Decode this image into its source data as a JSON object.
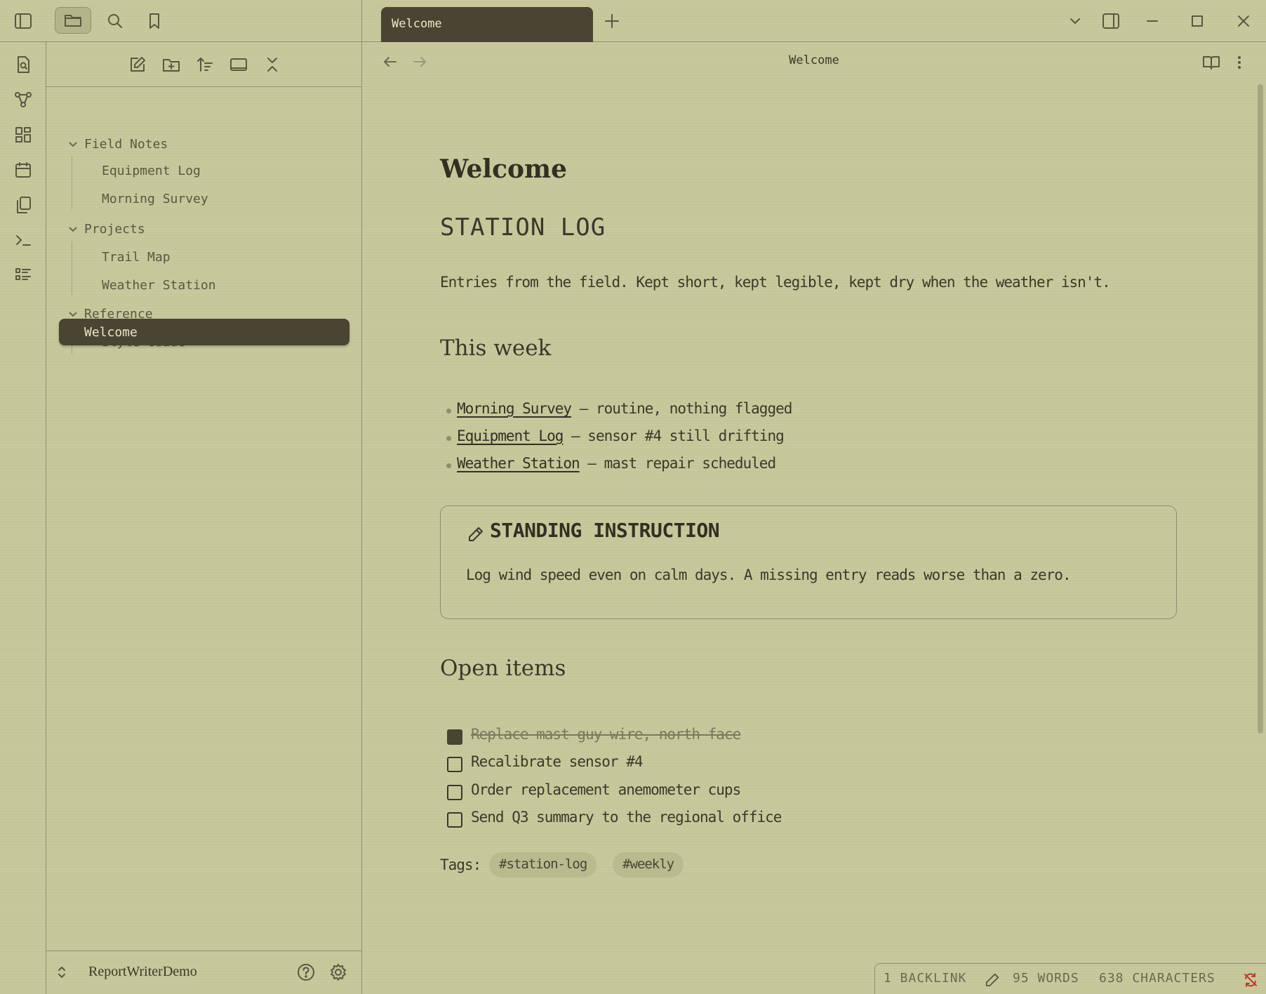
{
  "tabs": [
    {
      "label": "Welcome",
      "active": true
    }
  ],
  "view": {
    "title": "Welcome"
  },
  "file_tree": {
    "folders": [
      {
        "name": "Field Notes",
        "files": [
          "Equipment Log",
          "Morning Survey"
        ]
      },
      {
        "name": "Projects",
        "files": [
          "Trail Map",
          "Weather Station"
        ]
      },
      {
        "name": "Reference",
        "files": [
          "Style Guide"
        ]
      }
    ],
    "root_files": [
      "Welcome"
    ],
    "active": "Welcome"
  },
  "vault": {
    "name": "ReportWriterDemo"
  },
  "note": {
    "title": "Welcome",
    "heading": "STATION LOG",
    "intro": "Entries from the field. Kept short, kept legible, kept dry when the weather isn't.",
    "this_week_heading": "This week",
    "this_week": [
      {
        "link": "Morning Survey",
        "text": " — routine, nothing flagged"
      },
      {
        "link": "Equipment Log",
        "text": " — sensor #4 still drifting"
      },
      {
        "link": "Weather Station",
        "text": " — mast repair scheduled"
      }
    ],
    "callout": {
      "icon": "pencil-icon",
      "title": "STANDING INSTRUCTION",
      "body": "Log wind speed even on calm days. A missing entry reads worse than a zero."
    },
    "open_items_heading": "Open items",
    "tasks": [
      {
        "text": "Replace mast guy-wire, north face",
        "done": true
      },
      {
        "text": "Recalibrate sensor #4",
        "done": false
      },
      {
        "text": "Order replacement anemometer cups",
        "done": false
      },
      {
        "text": "Send Q3 summary to the regional office",
        "done": false
      }
    ],
    "tags_label": "Tags:",
    "tags": [
      "#station-log",
      "#weekly"
    ]
  },
  "status": {
    "backlinks": "1 BACKLINK",
    "words": "95 WORDS",
    "characters": "638 CHARACTERS"
  },
  "colors": {
    "accent": "#4a4432",
    "background": "#c7c99c",
    "sync_error": "#c0392b"
  }
}
